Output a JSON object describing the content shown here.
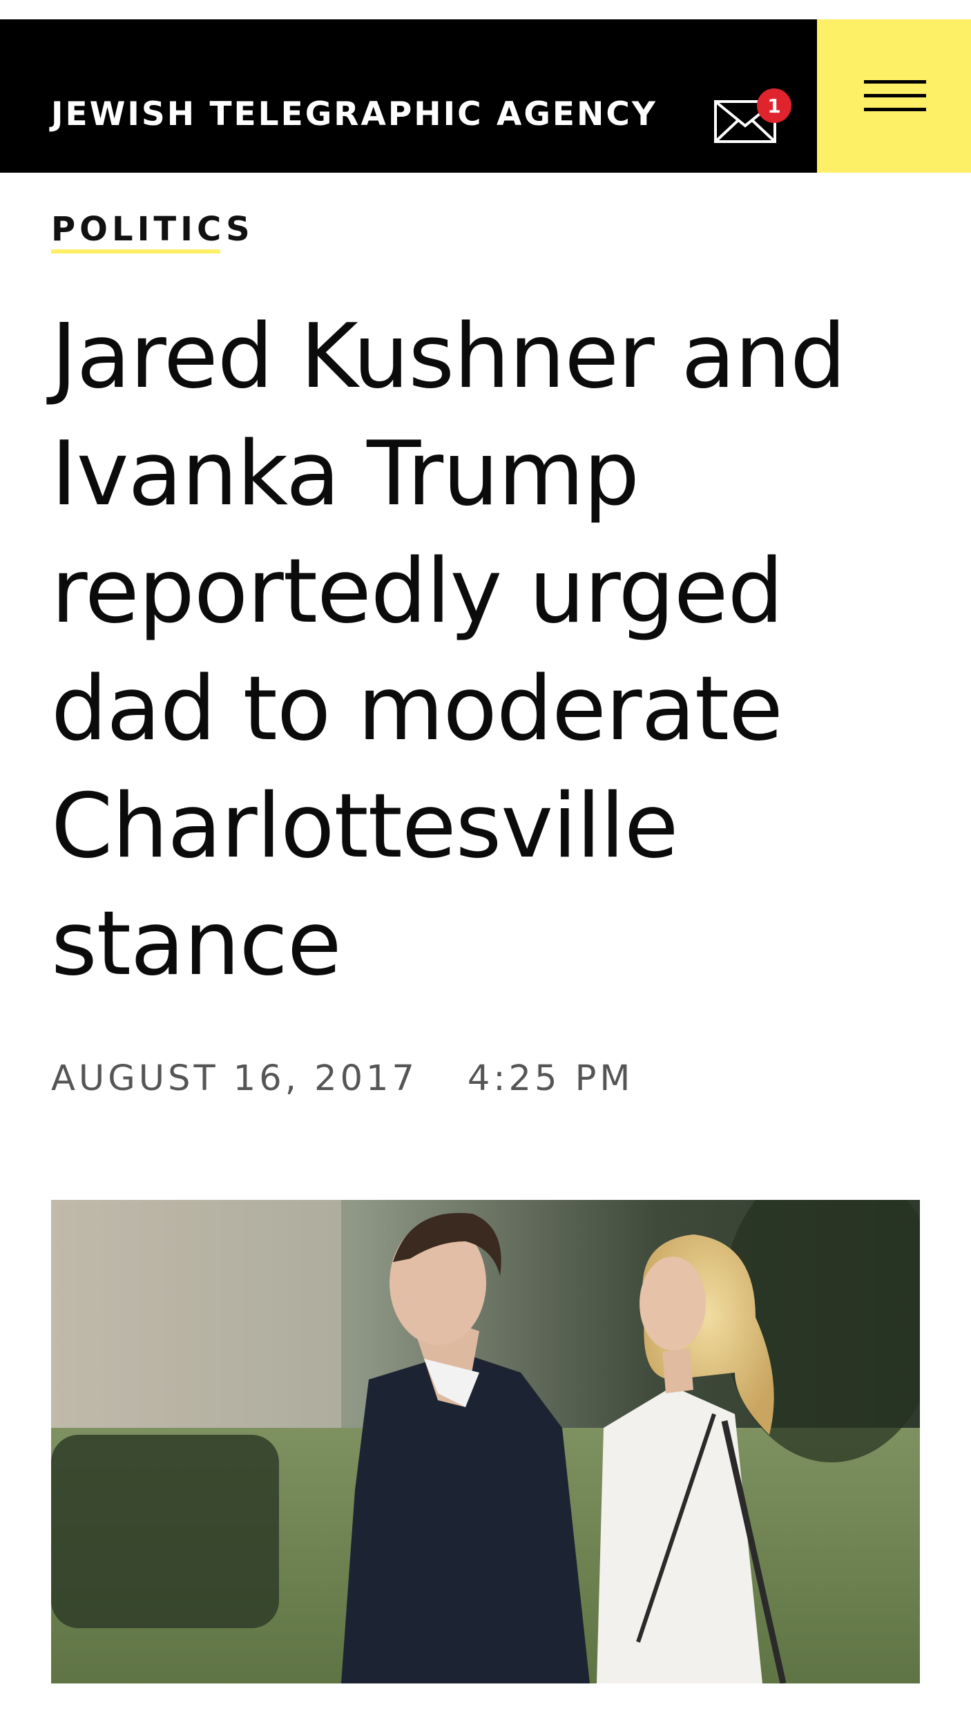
{
  "header": {
    "site_name": "JEWISH TELEGRAPHIC AGENCY",
    "notification_count": "1",
    "mail_icon": "envelope-icon",
    "menu_icon": "hamburger-menu-icon",
    "accent_color": "#fdf066",
    "badge_color": "#e0242e"
  },
  "article": {
    "category": "POLITICS",
    "headline": "Jared Kushner and Ivanka Trump reportedly urged dad to moderate Charlottesville stance",
    "date": "AUGUST 16, 2017",
    "time": "4:25 PM"
  }
}
